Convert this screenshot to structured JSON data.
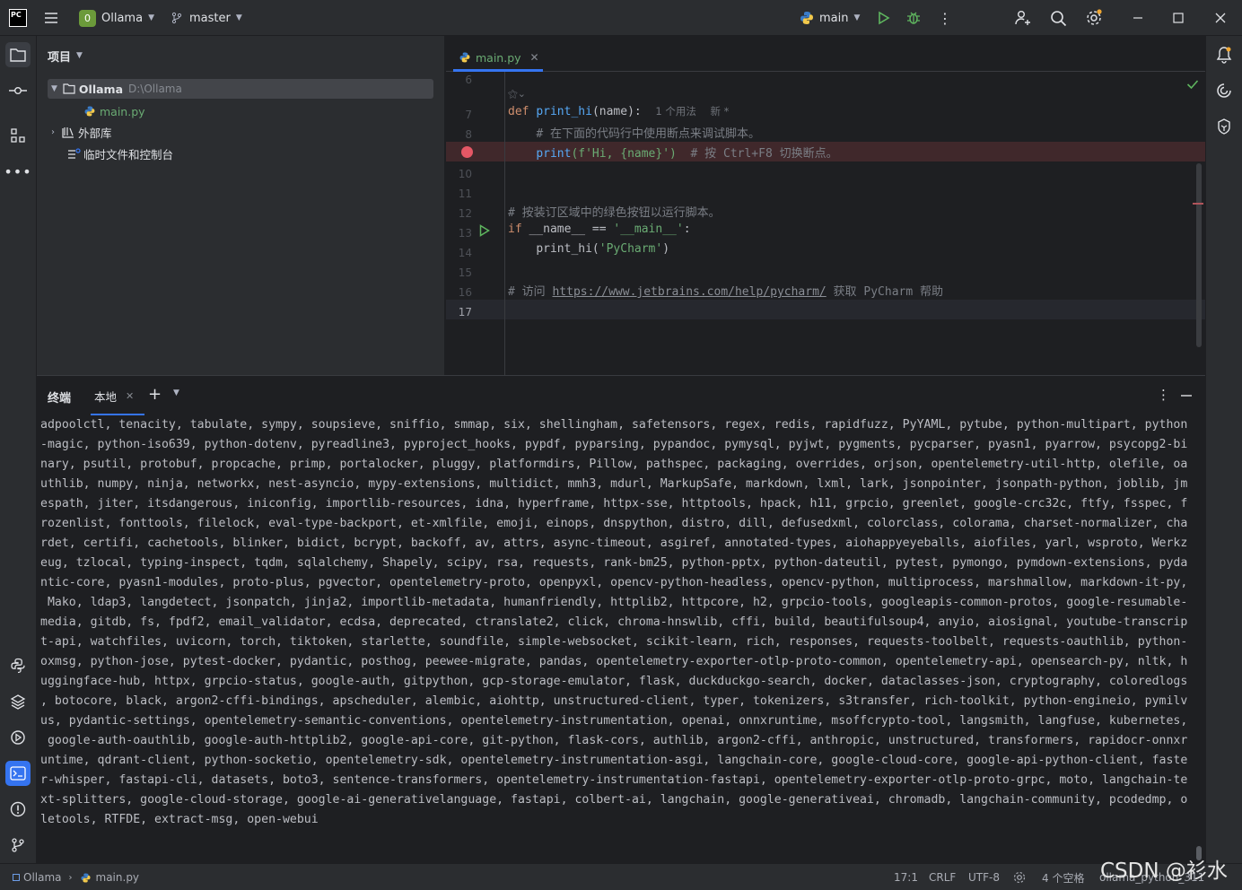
{
  "titlebar": {
    "app_badge": "PC",
    "project_initial": "0",
    "project_name": "Ollama",
    "branch": "master",
    "run_config": "main"
  },
  "project_panel": {
    "title": "项目",
    "root_name": "Ollama",
    "root_path": "D:\\Ollama",
    "file": "main.py",
    "external_libs": "外部库",
    "scratches": "临时文件和控制台"
  },
  "editor": {
    "tab_label": "main.py",
    "line_numbers": [
      "6",
      "",
      "7",
      "8",
      "9",
      "10",
      "11",
      "12",
      "13",
      "14",
      "15",
      "16",
      "17"
    ],
    "usage_hint": "1 个用法",
    "new_hint": "新 *",
    "lines": {
      "l7_def": "def",
      "l7_name": "print_hi",
      "l7_args": "(name):",
      "l8_comment": "# 在下面的代码行中使用断点来调试脚本。",
      "l9_print": "print",
      "l9_str": "(f'Hi, {name}')",
      "l9_comment": "  # 按 Ctrl+F8 切换断点。",
      "l12_comment": "# 按装订区域中的绿色按钮以运行脚本。",
      "l13_if": "if",
      "l13_rest": " __name__ == ",
      "l13_str": "'__main__'",
      "l13_colon": ":",
      "l14_call": "print_hi(",
      "l14_str": "'PyCharm'",
      "l14_close": ")",
      "l16_prefix": "# 访问 ",
      "l16_link": "https://www.jetbrains.com/help/pycharm/",
      "l16_suffix": " 获取 PyCharm 帮助"
    }
  },
  "terminal": {
    "title": "终端",
    "tab_label": "本地",
    "lines": [
      "adpoolctl, tenacity, tabulate, sympy, soupsieve, sniffio, smmap, six, shellingham, safetensors, regex, redis, rapidfuzz, PyYAML, pytube, python-multipart, python",
      "-magic, python-iso639, python-dotenv, pyreadline3, pyproject_hooks, pypdf, pyparsing, pypandoc, pymysql, pyjwt, pygments, pycparser, pyasn1, pyarrow, psycopg2-bi",
      "nary, psutil, protobuf, propcache, primp, portalocker, pluggy, platformdirs, Pillow, pathspec, packaging, overrides, orjson, opentelemetry-util-http, olefile, oa",
      "uthlib, numpy, ninja, networkx, nest-asyncio, mypy-extensions, multidict, mmh3, mdurl, MarkupSafe, markdown, lxml, lark, jsonpointer, jsonpath-python, joblib, jm",
      "espath, jiter, itsdangerous, iniconfig, importlib-resources, idna, hyperframe, httpx-sse, httptools, hpack, h11, grpcio, greenlet, google-crc32c, ftfy, fsspec, f",
      "rozenlist, fonttools, filelock, eval-type-backport, et-xmlfile, emoji, einops, dnspython, distro, dill, defusedxml, colorclass, colorama, charset-normalizer, cha",
      "rdet, certifi, cachetools, blinker, bidict, bcrypt, backoff, av, attrs, async-timeout, asgiref, annotated-types, aiohappyeyeballs, aiofiles, yarl, wsproto, Werkz",
      "eug, tzlocal, typing-inspect, tqdm, sqlalchemy, Shapely, scipy, rsa, requests, rank-bm25, python-pptx, python-dateutil, pytest, pymongo, pymdown-extensions, pyda",
      "ntic-core, pyasn1-modules, proto-plus, pgvector, opentelemetry-proto, openpyxl, opencv-python-headless, opencv-python, multiprocess, marshmallow, markdown-it-py,",
      " Mako, ldap3, langdetect, jsonpatch, jinja2, importlib-metadata, humanfriendly, httplib2, httpcore, h2, grpcio-tools, googleapis-common-protos, google-resumable-",
      "media, gitdb, fs, fpdf2, email_validator, ecdsa, deprecated, ctranslate2, click, chroma-hnswlib, cffi, build, beautifulsoup4, anyio, aiosignal, youtube-transcrip",
      "t-api, watchfiles, uvicorn, torch, tiktoken, starlette, soundfile, simple-websocket, scikit-learn, rich, responses, requests-toolbelt, requests-oauthlib, python-",
      "oxmsg, python-jose, pytest-docker, pydantic, posthog, peewee-migrate, pandas, opentelemetry-exporter-otlp-proto-common, opentelemetry-api, opensearch-py, nltk, h",
      "uggingface-hub, httpx, grpcio-status, google-auth, gitpython, gcp-storage-emulator, flask, duckduckgo-search, docker, dataclasses-json, cryptography, coloredlogs",
      ", botocore, black, argon2-cffi-bindings, apscheduler, alembic, aiohttp, unstructured-client, typer, tokenizers, s3transfer, rich-toolkit, python-engineio, pymilv",
      "us, pydantic-settings, opentelemetry-semantic-conventions, opentelemetry-instrumentation, openai, onnxruntime, msoffcrypto-tool, langsmith, langfuse, kubernetes,",
      " google-auth-oauthlib, google-auth-httplib2, google-api-core, git-python, flask-cors, authlib, argon2-cffi, anthropic, unstructured, transformers, rapidocr-onnxr",
      "untime, qdrant-client, python-socketio, opentelemetry-sdk, opentelemetry-instrumentation-asgi, langchain-core, google-cloud-core, google-api-python-client, faste",
      "r-whisper, fastapi-cli, datasets, boto3, sentence-transformers, opentelemetry-instrumentation-fastapi, opentelemetry-exporter-otlp-proto-grpc, moto, langchain-te",
      "xt-splitters, google-cloud-storage, google-ai-generativelanguage, fastapi, colbert-ai, langchain, google-generativeai, chromadb, langchain-community, pcodedmp, o",
      "letools, RTFDE, extract-msg, open-webui"
    ]
  },
  "statusbar": {
    "crumb_project": "Ollama",
    "crumb_file": "main.py",
    "position": "17:1",
    "line_sep": "CRLF",
    "encoding": "UTF-8",
    "indent": "4 个空格",
    "interpreter": "ollama_python_311",
    "watermark": "CSDN @衫水"
  },
  "colors": {
    "accent": "#3574f0",
    "run_green": "#5fb65f",
    "breakpoint": "#e55765",
    "project_badge": "#6b9a3a"
  }
}
